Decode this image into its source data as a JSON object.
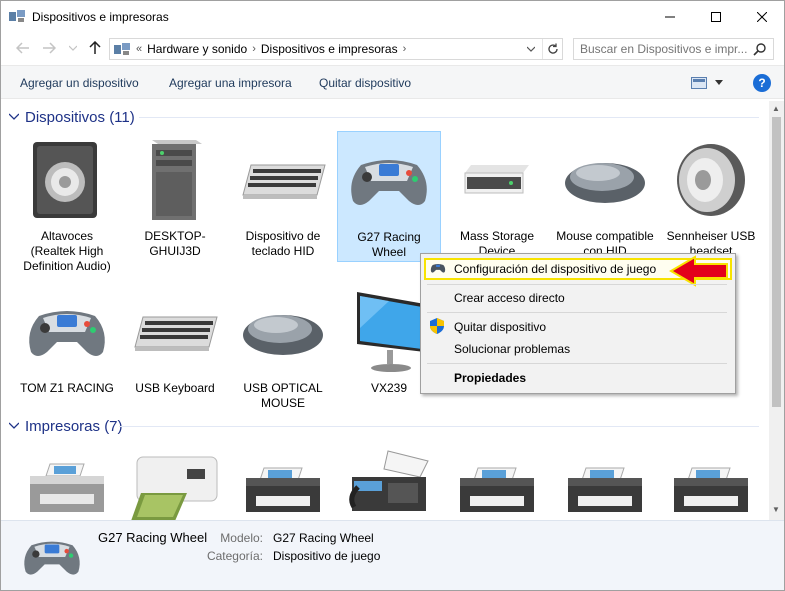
{
  "window": {
    "title": "Dispositivos e impresoras"
  },
  "address": {
    "overflow": "«",
    "crumbs": [
      "Hardware y sonido",
      "Dispositivos e impresoras"
    ],
    "search_placeholder": "Buscar en Dispositivos e impr..."
  },
  "toolbar": {
    "add_device": "Agregar un dispositivo",
    "add_printer": "Agregar una impresora",
    "remove_device": "Quitar dispositivo"
  },
  "groups": {
    "devices": "Dispositivos (11)",
    "printers": "Impresoras (7)"
  },
  "devices": [
    {
      "label": "Altavoces (Realtek High Definition Audio)",
      "icon": "speaker-icon"
    },
    {
      "label": "DESKTOP-GHUIJ3D",
      "icon": "computer-tower-icon"
    },
    {
      "label": "Dispositivo de teclado HID",
      "icon": "keyboard-icon"
    },
    {
      "label": "G27 Racing Wheel",
      "icon": "gamepad-icon"
    },
    {
      "label": "Mass Storage Device",
      "icon": "storage-drive-icon"
    },
    {
      "label": "Mouse compatible con HID",
      "icon": "mouse-icon"
    },
    {
      "label": "Sennheiser USB headset",
      "icon": "speaker-icon"
    },
    {
      "label": "TOM Z1 RACING",
      "icon": "gamepad-icon"
    },
    {
      "label": "USB Keyboard",
      "icon": "keyboard-icon"
    },
    {
      "label": "USB OPTICAL MOUSE",
      "icon": "mouse-icon"
    },
    {
      "label": "VX239",
      "icon": "monitor-icon"
    }
  ],
  "context_menu": {
    "game_config": "Configuración del dispositivo de juego",
    "create_shortcut": "Crear acceso directo",
    "remove_device": "Quitar dispositivo",
    "troubleshoot": "Solucionar problemas",
    "properties": "Propiedades"
  },
  "details": {
    "name": "G27 Racing Wheel",
    "model_label": "Modelo:",
    "model_value": "G27 Racing Wheel",
    "category_label": "Categoría:",
    "category_value": "Dispositivo de juego"
  },
  "colors": {
    "accent": "#1a6dd6",
    "group_header": "#1e3287",
    "selection": "#cce8ff",
    "highlight_border": "#f8e300",
    "arrow": "#e3001b"
  }
}
